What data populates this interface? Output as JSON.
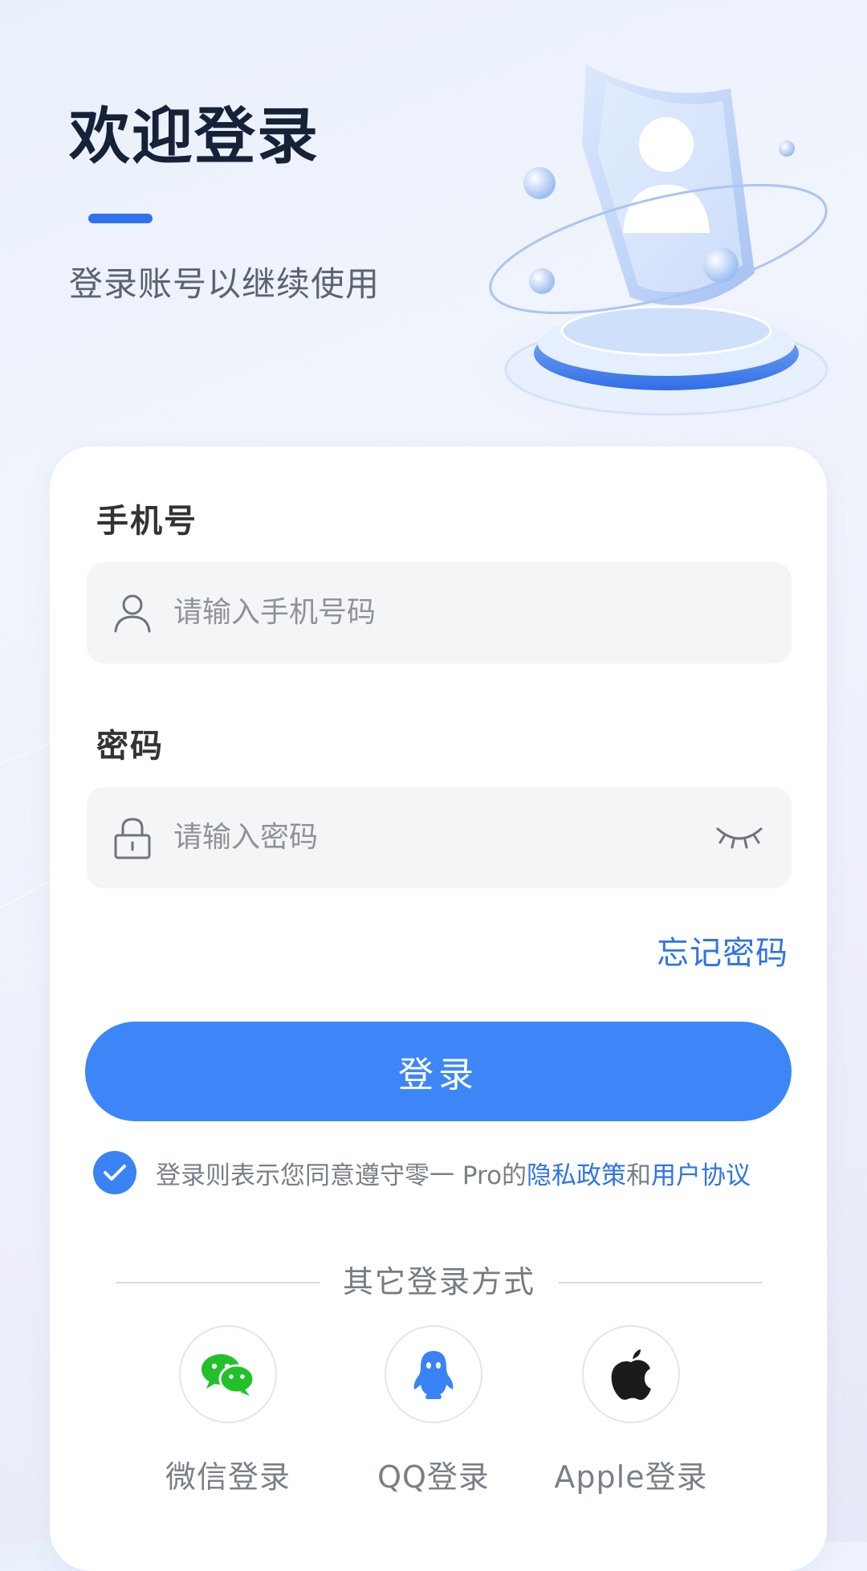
{
  "header": {
    "title": "欢迎登录",
    "subtitle": "登录账号以继续使用"
  },
  "form": {
    "phone_label": "手机号",
    "phone_placeholder": "请输入手机号码",
    "password_label": "密码",
    "password_placeholder": "请输入密码",
    "forgot_password": "忘记密码",
    "login_button": "登录"
  },
  "agreement": {
    "checked": true,
    "prefix": "登录则表示您同意遵守零一 Pro的",
    "privacy_link": "隐私政策",
    "and": "和",
    "terms_link": "用户协议"
  },
  "other_login": {
    "title": "其它登录方式",
    "options": [
      {
        "label": "微信登录",
        "icon": "wechat-icon"
      },
      {
        "label": "QQ登录",
        "icon": "qq-icon"
      },
      {
        "label": "Apple登录",
        "icon": "apple-icon"
      }
    ]
  },
  "colors": {
    "accent": "#3d86f7",
    "link": "#2e74e8",
    "wechat": "#22c02a",
    "qq": "#3a83f5",
    "apple": "#1b1b1b"
  }
}
